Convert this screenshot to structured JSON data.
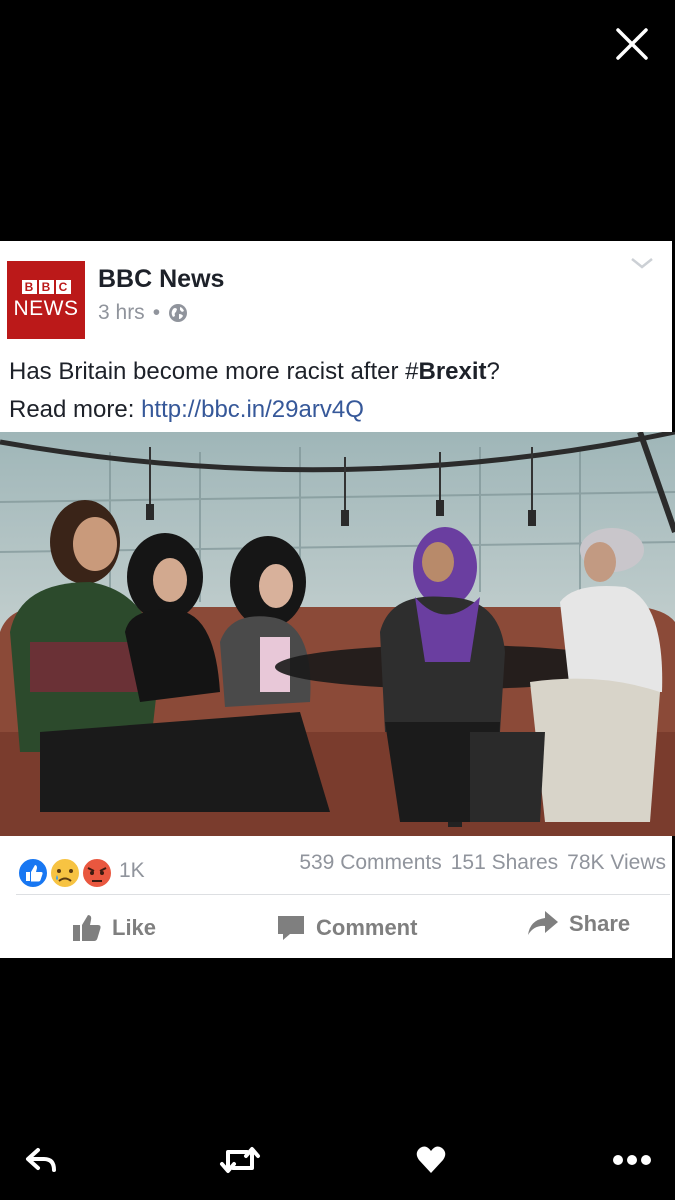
{
  "post": {
    "page_name": "BBC News",
    "logo_top_letters": [
      "B",
      "B",
      "C"
    ],
    "logo_bottom": "NEWS",
    "time": "3 hrs",
    "separator": "•",
    "text_before": "Has Britain become more racist after #",
    "text_bold": "Brexit",
    "text_after": "?",
    "read_more": "Read more: ",
    "link": "http://bbc.in/29arv4Q"
  },
  "stats": {
    "reactions": [
      "like-icon",
      "sad-icon",
      "angry-icon"
    ],
    "reaction_count": "1K",
    "comments": "539 Comments",
    "shares": "151 Shares",
    "views": "78K Views"
  },
  "actions": {
    "like": "Like",
    "comment": "Comment",
    "share": "Share"
  },
  "icons": {
    "close": "close-icon",
    "chevron": "chevron-down-icon",
    "globe": "globe-icon",
    "reply": "reply-icon",
    "retweet": "retweet-icon",
    "heart": "heart-icon",
    "more": "more-icon"
  },
  "colors": {
    "bbc_red": "#bb1919",
    "link_blue": "#365899",
    "like_blue": "#1877f2",
    "muted_gray": "#90949c",
    "purple_scarf": "#6a3ea0"
  }
}
